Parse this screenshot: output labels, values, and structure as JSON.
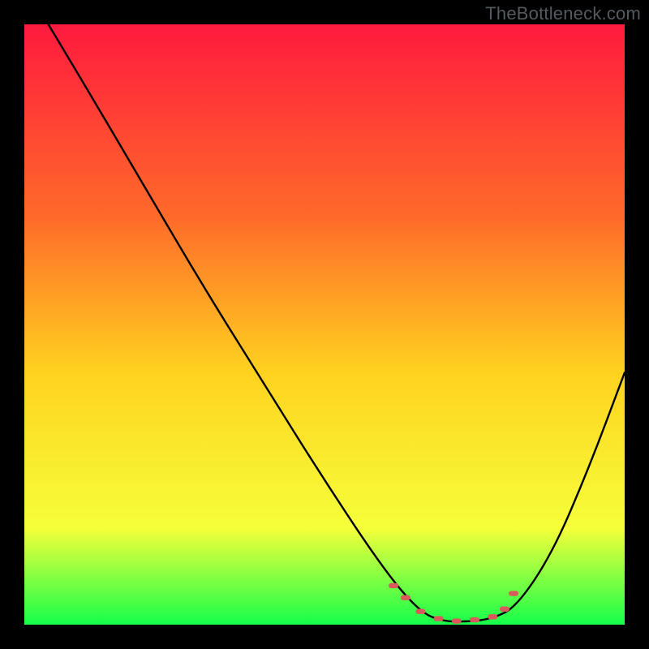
{
  "watermark": "TheBottleneck.com",
  "icon_name": "bottleneck-curve-chart",
  "gradient": {
    "top": "#ff1a3e",
    "mid_upper": "#ff6a2a",
    "mid": "#ffd21f",
    "mid_lower": "#f5ff3a",
    "bottom": "#16ff4a"
  },
  "curve_color": "#000000",
  "marker_color": "#d95a5a",
  "chart_data": {
    "type": "line",
    "title": "",
    "xlabel": "",
    "ylabel": "",
    "xlim": [
      0,
      100
    ],
    "ylim": [
      0,
      100
    ],
    "series": [
      {
        "name": "bottleneck-curve",
        "x": [
          4,
          10,
          20,
          30,
          40,
          50,
          60,
          66,
          70,
          74,
          78,
          82,
          88,
          94,
          100
        ],
        "y": [
          100,
          90,
          73,
          56,
          40,
          24,
          9,
          2,
          0.5,
          0.5,
          1,
          3,
          12,
          26,
          42
        ]
      }
    ],
    "markers": {
      "name": "optimal-range",
      "x": [
        61.5,
        63.5,
        66,
        69,
        72,
        75,
        78,
        80,
        81.5
      ],
      "y": [
        6.5,
        4.5,
        2.2,
        1.0,
        0.6,
        0.8,
        1.3,
        2.6,
        5.2
      ]
    }
  }
}
